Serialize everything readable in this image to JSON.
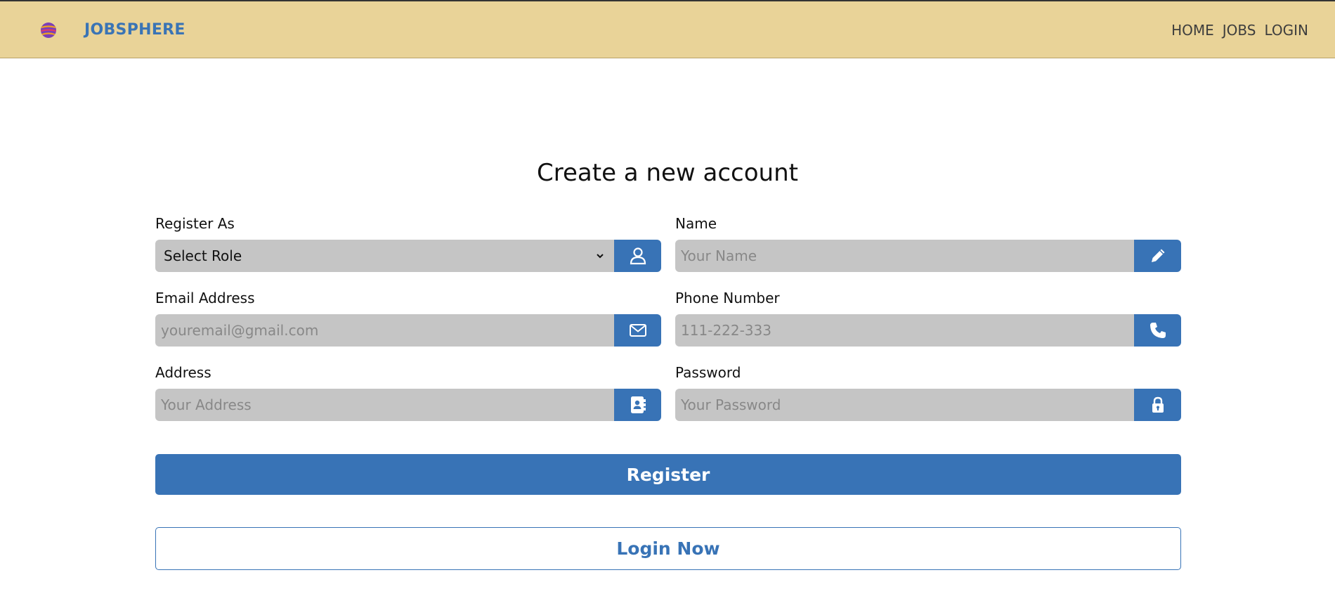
{
  "brand": {
    "name": "JOBSPHERE",
    "logo_icon": "globe-logo-icon"
  },
  "nav": {
    "links": [
      "HOME",
      "JOBS",
      "LOGIN"
    ]
  },
  "form": {
    "title": "Create a new account",
    "fields": {
      "role": {
        "label": "Register As",
        "value": "Select Role",
        "icon": "user-icon"
      },
      "name": {
        "label": "Name",
        "placeholder": "Your Name",
        "icon": "pencil-icon"
      },
      "email": {
        "label": "Email Address",
        "placeholder": "youremail@gmail.com",
        "icon": "envelope-icon"
      },
      "phone": {
        "label": "Phone Number",
        "placeholder": "111-222-333",
        "icon": "phone-icon"
      },
      "address": {
        "label": "Address",
        "placeholder": "Your Address",
        "icon": "address-book-icon"
      },
      "password": {
        "label": "Password",
        "placeholder": "Your Password",
        "icon": "lock-icon"
      }
    },
    "register_label": "Register",
    "login_label": "Login Now"
  },
  "colors": {
    "navbar": "#e9d398",
    "accent": "#3873b6",
    "input_bg": "#c5c5c5"
  }
}
